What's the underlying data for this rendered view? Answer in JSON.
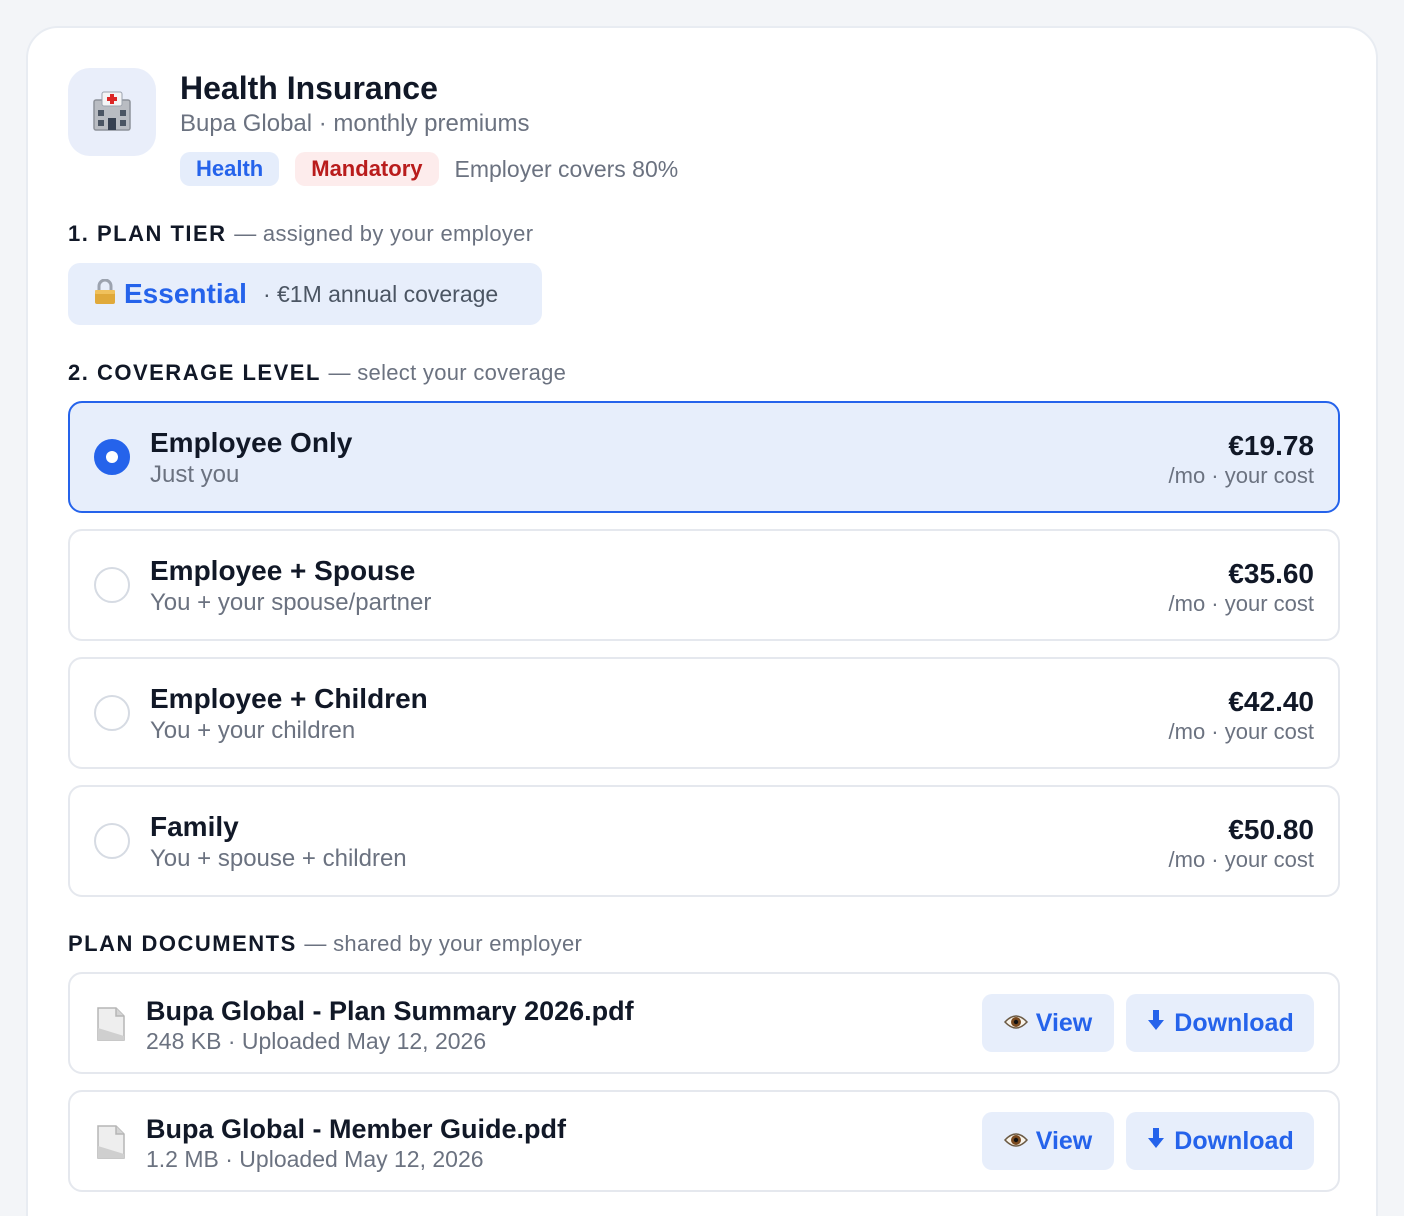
{
  "header": {
    "icon": "hospital-icon",
    "title": "Health Insurance",
    "subtitle": "Bupa Global · monthly premiums",
    "tags": {
      "category": "Health",
      "status": "Mandatory"
    },
    "note": "Employer covers 80%"
  },
  "plan_tier": {
    "section_number_title": "1. PLAN TIER",
    "section_hint": "— assigned by your employer",
    "lock_icon": "lock-icon",
    "name": "Essential",
    "coverage": "· €1M annual coverage"
  },
  "coverage": {
    "section_number_title": "2. COVERAGE LEVEL",
    "section_hint": "— select your coverage",
    "selected_index": 0,
    "options": [
      {
        "title": "Employee Only",
        "subtitle": "Just you",
        "price": "€19.78",
        "unit": "/mo · your cost"
      },
      {
        "title": "Employee + Spouse",
        "subtitle": "You + your spouse/partner",
        "price": "€35.60",
        "unit": "/mo · your cost"
      },
      {
        "title": "Employee + Children",
        "subtitle": "You + your children",
        "price": "€42.40",
        "unit": "/mo · your cost"
      },
      {
        "title": "Family",
        "subtitle": "You + spouse + children",
        "price": "€50.80",
        "unit": "/mo · your cost"
      }
    ]
  },
  "documents": {
    "section_title": "PLAN DOCUMENTS",
    "section_hint": "— shared by your employer",
    "view_label": "View",
    "download_label": "Download",
    "items": [
      {
        "name": "Bupa Global - Plan Summary 2026.pdf",
        "meta": "248 KB · Uploaded May 12, 2026"
      },
      {
        "name": "Bupa Global - Member Guide.pdf",
        "meta": "1.2 MB · Uploaded May 12, 2026"
      }
    ]
  },
  "colors": {
    "accent": "#2563eb",
    "accent_bg": "#e7eefb",
    "danger": "#b91c1c",
    "danger_bg": "#fdecec",
    "muted_text": "#6b7280"
  }
}
